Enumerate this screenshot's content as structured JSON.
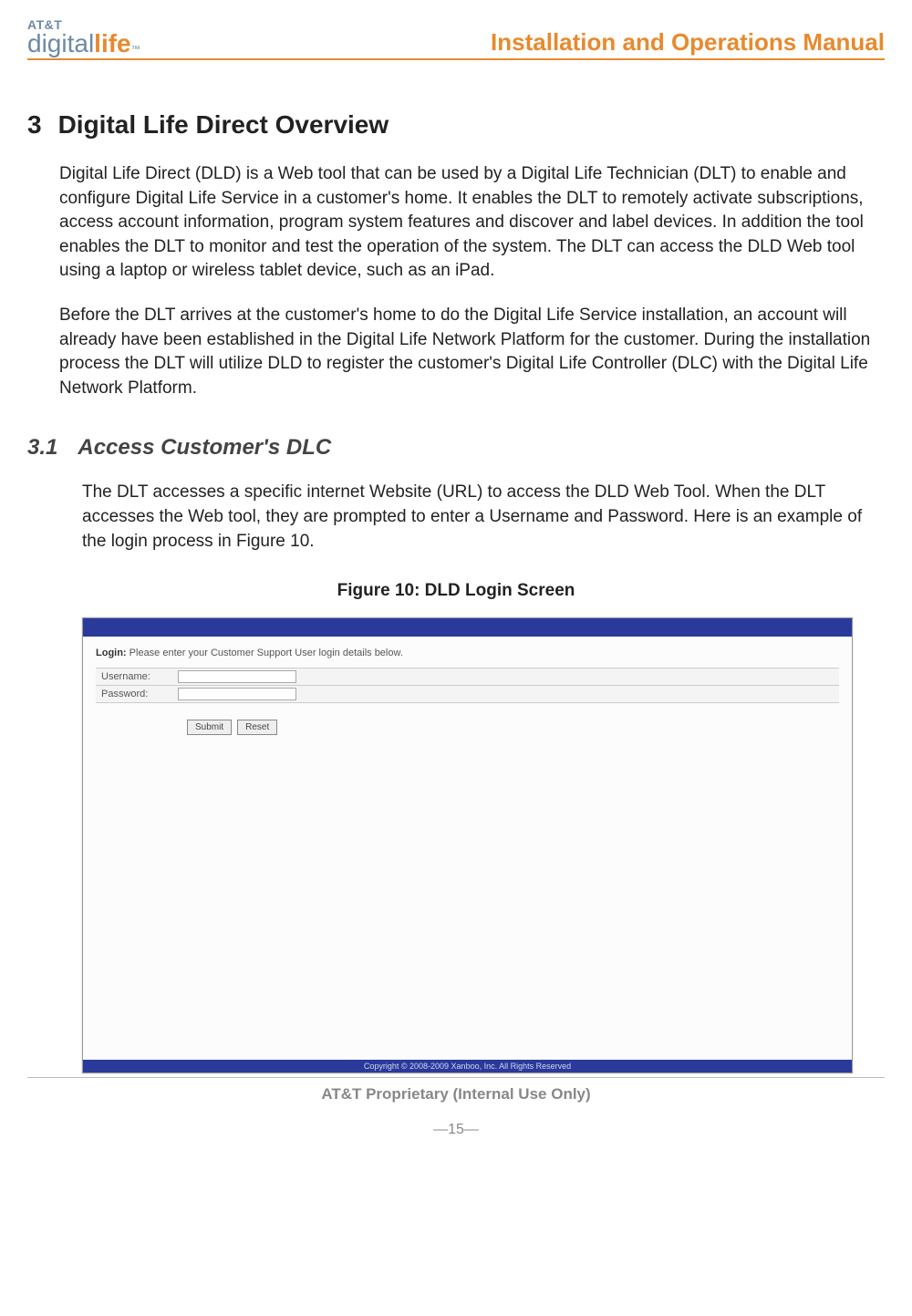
{
  "header": {
    "logo_att": "AT&T",
    "logo_digital": "digital",
    "logo_life": "life",
    "logo_tm": "™",
    "doc_title": "Installation and Operations Manual"
  },
  "section": {
    "number": "3",
    "title": "Digital Life Direct Overview",
    "para1": "Digital Life Direct (DLD) is a Web tool that can be used by a Digital Life Technician (DLT) to enable and configure Digital Life Service in a customer's home. It enables the DLT to remotely activate subscriptions, access account information, program system features and discover and label devices. In addition the tool enables the DLT to monitor and test the operation of the system. The DLT can access the DLD Web tool using a laptop or wireless tablet device, such as an iPad.",
    "para2": "Before the DLT arrives at the customer's home to do the Digital Life Service installation, an account will already have been established in the Digital Life Network Platform for the customer. During the installation process the DLT will utilize DLD to register the customer's Digital Life Controller (DLC) with the Digital Life Network Platform."
  },
  "subsection": {
    "number": "3.1",
    "title": "Access Customer's DLC",
    "para1": "The DLT accesses a specific internet Website (URL) to access the DLD Web Tool. When the DLT accesses the Web tool, they are prompted to enter a Username and Password. Here is an example of the login process in Figure 10."
  },
  "figure": {
    "caption": "Figure 10:  DLD Login Screen",
    "login_bold": "Login:",
    "login_text": " Please enter your Customer Support User login details below.",
    "username_label": "Username:",
    "password_label": "Password:",
    "submit_label": "Submit",
    "reset_label": "Reset",
    "copyright": "Copyright © 2008-2009 Xanboo, Inc. All Rights Reserved"
  },
  "footer": {
    "proprietary": "AT&T Proprietary (Internal Use Only)",
    "page_number": "—15—"
  }
}
